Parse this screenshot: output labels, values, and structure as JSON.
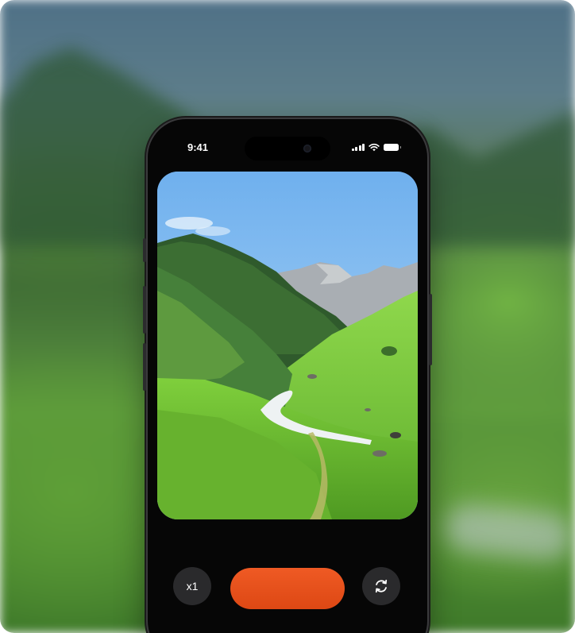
{
  "status_bar": {
    "time": "9:41",
    "icons": [
      "cellular-signal-icon",
      "wifi-icon",
      "battery-icon"
    ]
  },
  "camera": {
    "zoom_label": "x1",
    "record_button_color": "#E4501A",
    "flip_camera_icon": "camera-rotate-icon"
  },
  "colors": {
    "accent": "#E4501A",
    "phone_body": "#060606",
    "control_button": "#2A2A2C"
  }
}
